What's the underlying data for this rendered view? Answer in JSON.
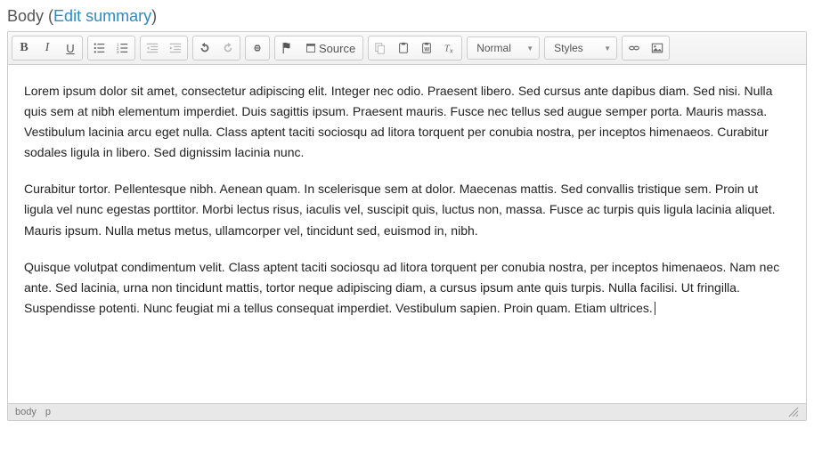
{
  "field": {
    "label": "Body",
    "edit_summary_text": "Edit summary"
  },
  "dropdowns": {
    "format_label": "Normal",
    "styles_label": "Styles"
  },
  "source_button": "Source",
  "content": {
    "p1": "Lorem ipsum dolor sit amet, consectetur adipiscing elit. Integer nec odio. Praesent libero. Sed cursus ante dapibus diam. Sed nisi. Nulla quis sem at nibh elementum imperdiet. Duis sagittis ipsum. Praesent mauris. Fusce nec tellus sed augue semper porta. Mauris massa. Vestibulum lacinia arcu eget nulla. Class aptent taciti sociosqu ad litora torquent per conubia nostra, per inceptos himenaeos. Curabitur sodales ligula in libero. Sed dignissim lacinia nunc.",
    "p2": "Curabitur tortor. Pellentesque nibh. Aenean quam. In scelerisque sem at dolor. Maecenas mattis. Sed convallis tristique sem. Proin ut ligula vel nunc egestas porttitor. Morbi lectus risus, iaculis vel, suscipit quis, luctus non, massa. Fusce ac turpis quis ligula lacinia aliquet. Mauris ipsum. Nulla metus metus, ullamcorper vel, tincidunt sed, euismod in, nibh.",
    "p3": "Quisque volutpat condimentum velit. Class aptent taciti sociosqu ad litora torquent per conubia nostra, per inceptos himenaeos. Nam nec ante. Sed lacinia, urna non tincidunt mattis, tortor neque adipiscing diam, a cursus ipsum ante quis turpis. Nulla facilisi. Ut fringilla. Suspendisse potenti. Nunc feugiat mi a tellus consequat imperdiet. Vestibulum sapien. Proin quam. Etiam ultrices."
  },
  "path": {
    "item1": "body",
    "item2": "p"
  }
}
